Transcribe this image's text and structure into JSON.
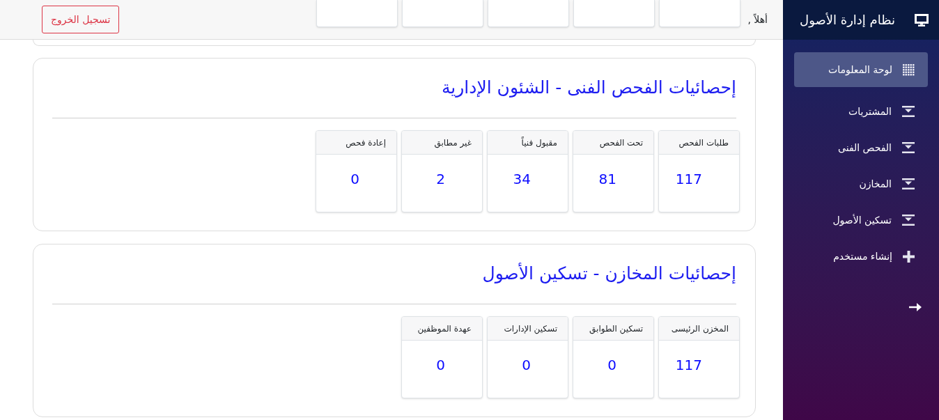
{
  "sidebar": {
    "title": "نظام إدارة الأصول",
    "items": [
      {
        "label": "لوحة المعلومات",
        "kind": "dashboard",
        "selected": true
      },
      {
        "label": "المشتريات",
        "kind": "menu",
        "selected": false
      },
      {
        "label": "الفحص الفنى",
        "kind": "menu",
        "selected": false
      },
      {
        "label": "المخازن",
        "kind": "menu",
        "selected": false
      },
      {
        "label": "تسكين الأصول",
        "kind": "menu",
        "selected": false
      },
      {
        "label": "إنشاء مستخدم",
        "kind": "create",
        "selected": false
      }
    ]
  },
  "header": {
    "greeting": "أهلاً ,",
    "logout_button": "تسجيل الخروج"
  },
  "cards": [
    {
      "title": "إحصائيات الفحص الفنى - الشئون الإدارية",
      "stats": [
        {
          "label": "طلبات الفحص",
          "value": "117"
        },
        {
          "label": "تحت الفحص",
          "value": "81"
        },
        {
          "label": "مقبول فنياً",
          "value": "34"
        },
        {
          "label": "غير مطابق",
          "value": "2"
        },
        {
          "label": "إعادة فحص",
          "value": "0"
        }
      ]
    },
    {
      "title": "إحصائيات المخازن - تسكين الأصول",
      "stats": [
        {
          "label": "المخزن الرئيسى",
          "value": "117"
        },
        {
          "label": "تسكين الطوابق",
          "value": "0"
        },
        {
          "label": "تسكين الإدارات",
          "value": "0"
        },
        {
          "label": "عهدة الموظفين",
          "value": "0"
        }
      ]
    }
  ]
}
